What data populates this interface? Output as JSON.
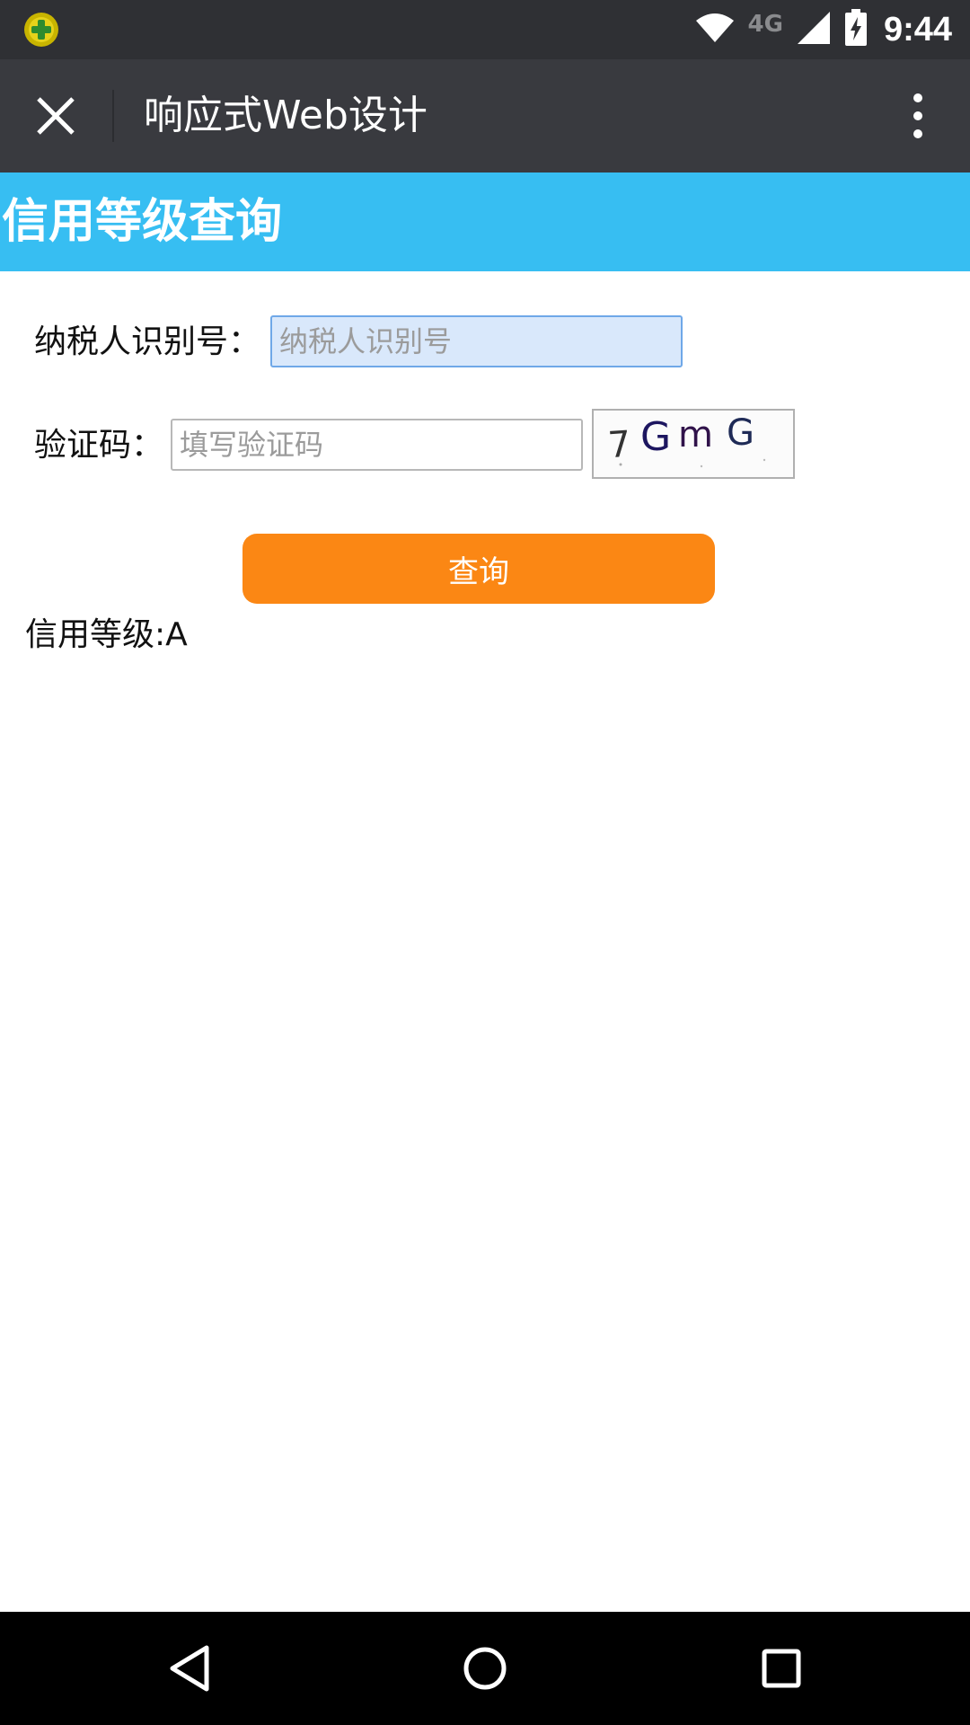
{
  "status_bar": {
    "time": "9:44",
    "network": "4G",
    "icons": [
      "app-360-icon",
      "wifi-icon",
      "cellular-signal-icon",
      "battery-charging-icon"
    ]
  },
  "toolbar": {
    "title": "响应式Web设计",
    "close_icon": "close-icon",
    "more_icon": "more-vertical-icon"
  },
  "page": {
    "heading": "信用等级查询",
    "header_color": "#37bef2"
  },
  "form": {
    "taxpayer_label": "纳税人识别号：",
    "taxpayer_placeholder": "纳税人识别号",
    "taxpayer_value": "",
    "captcha_label": "验证码：",
    "captcha_placeholder": "填写验证码",
    "captcha_value": "",
    "captcha_text": "7GmG",
    "submit_label": "查询",
    "submit_color": "#fb8714"
  },
  "result": {
    "text": "信用等级:A"
  },
  "nav_bar": {
    "icons": [
      "back-icon",
      "home-icon",
      "recents-icon"
    ]
  }
}
